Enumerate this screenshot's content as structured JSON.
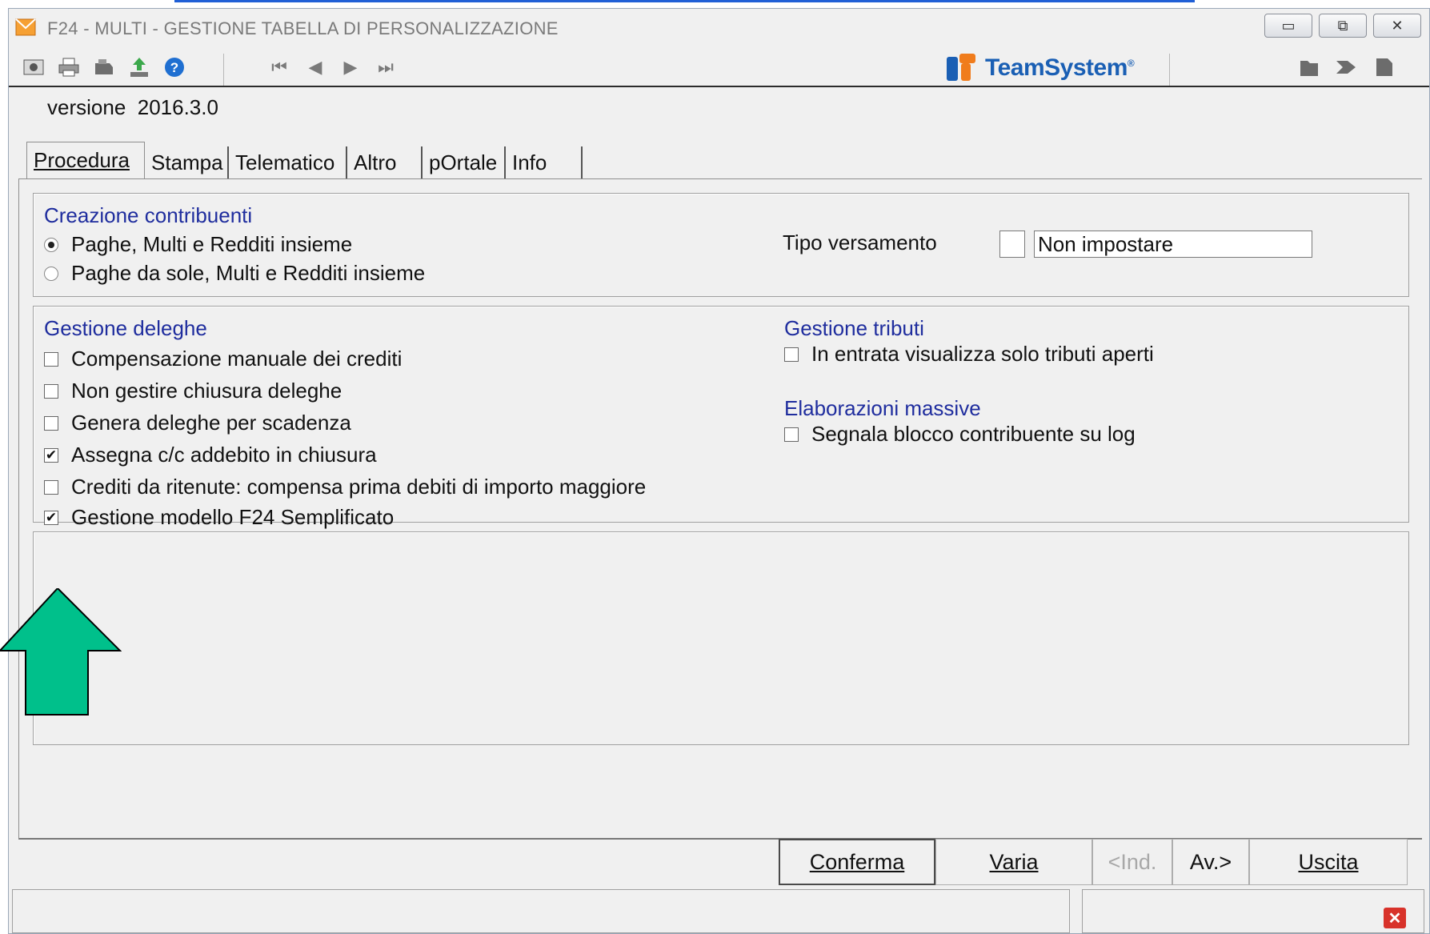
{
  "window": {
    "title": "F24  - MULTI -  GESTIONE TABELLA DI PERSONALIZZAZIONE",
    "controls": {
      "minimize": "▭",
      "restore": "⧉",
      "close": "✕"
    }
  },
  "toolbar": {
    "icons": [
      "preview-icon",
      "print-icon",
      "fax-icon",
      "export-icon",
      "help-icon"
    ],
    "nav": {
      "first": "⏮",
      "prev": "◀",
      "next": "▶",
      "last": "⏭"
    },
    "brand": "TeamSystem",
    "brand_mark": "®",
    "right_icons": [
      "folder-icon",
      "forward-icon",
      "document-icon"
    ]
  },
  "version": {
    "label": "versione",
    "value": "2016.3.0"
  },
  "tabs": [
    {
      "label": "Procedura",
      "active": true
    },
    {
      "label": "Stampa"
    },
    {
      "label": "Telematico"
    },
    {
      "label": "Altro"
    },
    {
      "label": "pOrtale"
    },
    {
      "label": "Info"
    }
  ],
  "creazione": {
    "title": "Creazione contribuenti",
    "options": [
      {
        "label": "Paghe, Multi e Redditi insieme",
        "selected": true
      },
      {
        "label": "Paghe da sole, Multi e Redditi insieme",
        "selected": false
      }
    ],
    "tipo_versamento": {
      "label": "Tipo versamento",
      "code": "",
      "value": "Non impostare"
    }
  },
  "deleghe": {
    "title": "Gestione deleghe",
    "items": [
      {
        "label": "Compensazione manuale dei crediti",
        "checked": false
      },
      {
        "label": "Non gestire chiusura deleghe",
        "checked": false
      },
      {
        "label": "Genera deleghe per scadenza",
        "checked": false
      },
      {
        "label": "Assegna c/c addebito in chiusura",
        "checked": true
      },
      {
        "label": "Crediti da ritenute: compensa prima debiti di importo maggiore",
        "checked": false
      },
      {
        "label": "Gestione modello F24 Semplificato",
        "checked": true
      }
    ]
  },
  "tributi": {
    "title": "Gestione tributi",
    "items": [
      {
        "label": "In entrata visualizza solo tributi aperti",
        "checked": false
      }
    ]
  },
  "massive": {
    "title": "Elaborazioni massive",
    "items": [
      {
        "label": "Segnala blocco contribuente su log",
        "checked": false
      }
    ]
  },
  "buttons": {
    "conferma": "Conferma",
    "varia": "Varia",
    "ind": "<Ind.",
    "av": "Av.>",
    "uscita": "Uscita"
  },
  "colors": {
    "group_title": "#1f2d9e",
    "arrow": "#00c08b",
    "brand": "#1a5fb4"
  }
}
